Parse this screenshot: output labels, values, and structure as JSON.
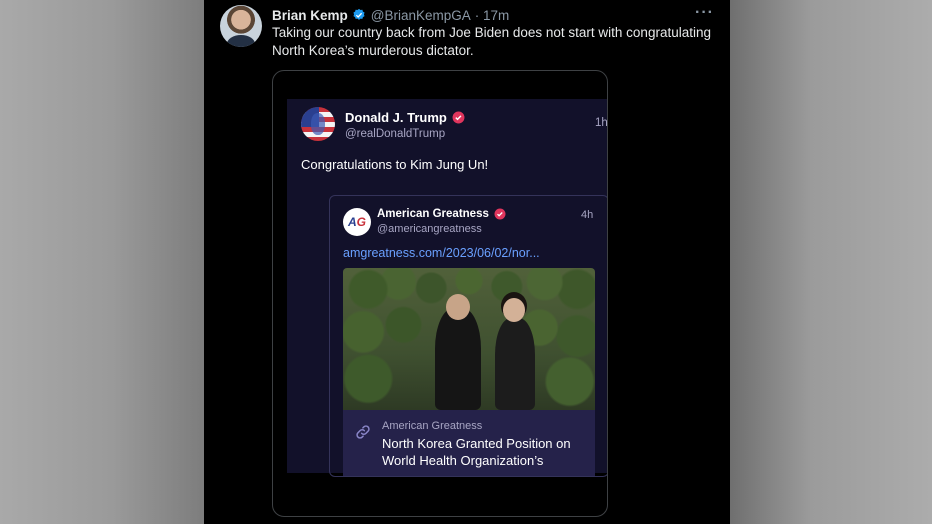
{
  "tweet": {
    "author_name": "Brian Kemp",
    "author_handle": "@BrianKempGA",
    "timestamp": "· 17m",
    "more_label": "···",
    "text": "Taking our country back from Joe Biden does not start with congratulating North Korea’s murderous dictator."
  },
  "embedded_post": {
    "author_name": "Donald J. Trump",
    "author_handle": "@realDonaldTrump",
    "timestamp": "1h",
    "text": "Congratulations to Kim Jung Un!",
    "quoted_post": {
      "author_name": "American Greatness",
      "author_handle": "@americangreatness",
      "timestamp": "4h",
      "avatar_letters_a": "A",
      "avatar_letters_g": "G",
      "link": "amgreatness.com/2023/06/02/nor...",
      "link_card": {
        "site": "American Greatness",
        "title": "North Korea Granted Position on World Health Organization’s"
      }
    }
  },
  "colors": {
    "twitter_verified": "#1d9bf0",
    "truth_badge": "#e0355d",
    "truth_background": "#12112a",
    "link": "#6aa0ff"
  }
}
